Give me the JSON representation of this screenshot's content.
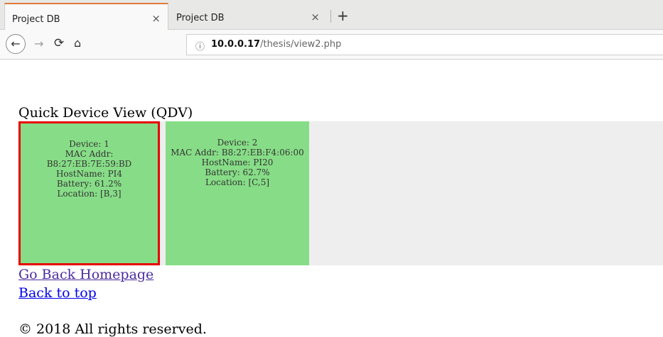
{
  "browser": {
    "tabs": [
      {
        "title": "Project DB",
        "close": "×"
      },
      {
        "title": "Project DB",
        "close": "×"
      }
    ],
    "new_tab": "+",
    "nav": {
      "back": "←",
      "forward": "→",
      "reload": "⟳",
      "home": "⌂"
    },
    "url": {
      "host": "10.0.0.17",
      "path": "/thesis/view2.php"
    }
  },
  "page": {
    "heading": "Quick Device View (QDV)",
    "devices": [
      {
        "device": "Device: 1",
        "mac_label": "MAC Addr:",
        "mac": "B8:27:EB:7E:59:BD",
        "hostname": "HostName: PI4",
        "battery": "Battery: 61.2%",
        "location": "Location: [B,3]",
        "selected": true
      },
      {
        "device": "Device: 2",
        "mac_full": "MAC Addr: B8:27:EB:F4:06:00",
        "hostname": "HostName: PI20",
        "battery": "Battery: 62.7%",
        "location": "Location: [C,5]",
        "selected": false
      }
    ],
    "links": {
      "home": "Go Back Homepage",
      "top": "Back to top"
    },
    "footer": "© 2018 All rights reserved."
  },
  "colors": {
    "device_bg": "#87dd87",
    "selected_border": "#e80000",
    "grid_bg": "#eeeeee",
    "tab_accent": "#e07b39"
  }
}
